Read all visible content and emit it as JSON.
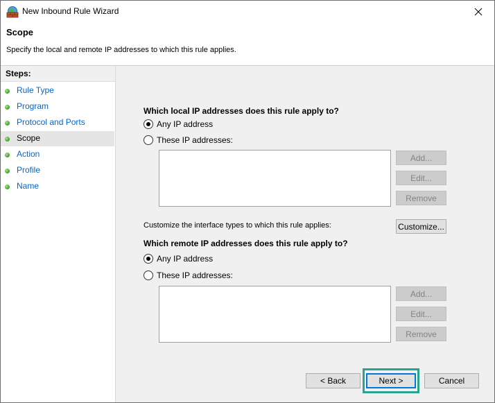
{
  "window": {
    "title": "New Inbound Rule Wizard"
  },
  "header": {
    "title": "Scope",
    "description": "Specify the local and remote IP addresses to which this rule applies."
  },
  "sidebar": {
    "steps_label": "Steps:",
    "items": [
      {
        "label": "Rule Type"
      },
      {
        "label": "Program"
      },
      {
        "label": "Protocol and Ports"
      },
      {
        "label": "Scope"
      },
      {
        "label": "Action"
      },
      {
        "label": "Profile"
      },
      {
        "label": "Name"
      }
    ],
    "active_index": 3
  },
  "local": {
    "question": "Which local IP addresses does this rule apply to?",
    "any_label": "Any IP address",
    "these_label": "These IP addresses:",
    "selected": "any",
    "add_label": "Add...",
    "edit_label": "Edit...",
    "remove_label": "Remove"
  },
  "customize": {
    "text": "Customize the interface types to which this rule applies:",
    "button_label": "Customize..."
  },
  "remote": {
    "question": "Which remote IP addresses does this rule apply to?",
    "any_label": "Any IP address",
    "these_label": "These IP addresses:",
    "selected": "any",
    "add_label": "Add...",
    "edit_label": "Edit...",
    "remove_label": "Remove"
  },
  "footer": {
    "back_label": "< Back",
    "next_label": "Next >",
    "cancel_label": "Cancel"
  },
  "colors": {
    "link": "#0066cc",
    "highlight": "#2aa38e",
    "panel_bg": "#f0f0f0"
  }
}
